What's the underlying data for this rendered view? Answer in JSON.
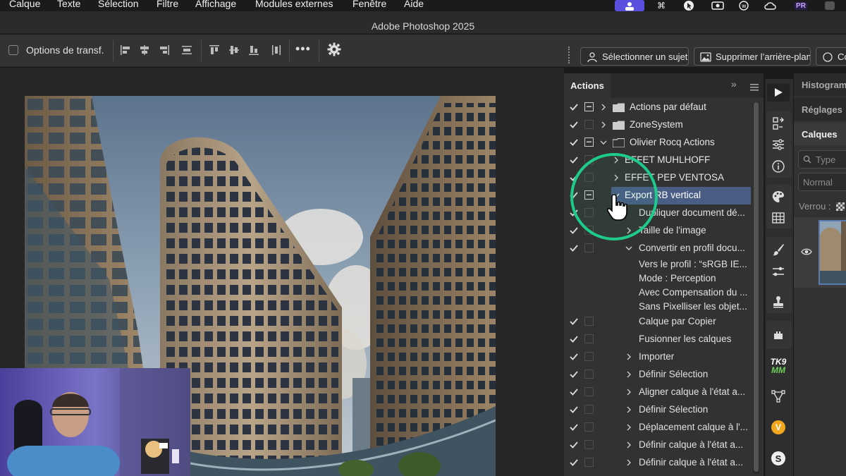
{
  "menubar": {
    "items": [
      "Calque",
      "Texte",
      "Sélection",
      "Filtre",
      "Affichage",
      "Modules externes",
      "Fenêtre",
      "Aide"
    ],
    "tray_icons": [
      "profile-icon",
      "command-icon",
      "cursor-icon",
      "camera-icon",
      "whatsapp-icon",
      "creative-cloud-icon",
      "premiere-icon",
      "app-icon"
    ],
    "tray_labels": {
      "premiere": "PR"
    }
  },
  "window": {
    "title": "Adobe Photoshop 2025"
  },
  "options_bar": {
    "transform_label": "Options de transf.",
    "more_label": "•••"
  },
  "contextual_bar": {
    "select_subject": "Sélectionner un sujet",
    "remove_background": "Supprimer l’arrière-plan",
    "third_button": "Co"
  },
  "actions_panel": {
    "tab": "Actions",
    "collapse_label": "»",
    "sets": [
      {
        "label": "Actions par défaut",
        "checked": true,
        "dialog": true,
        "expanded": false
      },
      {
        "label": "ZoneSystem",
        "checked": true,
        "dialog": false,
        "expanded": false
      },
      {
        "label": "Olivier Rocq Actions",
        "checked": true,
        "dialog": true,
        "expanded": true
      }
    ],
    "actions": [
      {
        "label": "EFFET MUHLHOFF",
        "checked": true,
        "expanded": false
      },
      {
        "label": "EFFET PEP VENTOSA",
        "checked": true,
        "expanded": false
      },
      {
        "label": "Export RB vertical",
        "checked": true,
        "dialog": true,
        "expanded": true,
        "selected": true
      }
    ],
    "steps": [
      {
        "label": "Dupliquer document dé...",
        "expandable": false
      },
      {
        "label": "Taille de l'image",
        "expandable": true,
        "expanded": false
      },
      {
        "label": "Convertir en profil docu...",
        "expandable": true,
        "expanded": true
      },
      {
        "label": "Calque par Copier",
        "expandable": false
      },
      {
        "label": "Fusionner les calques",
        "expandable": false
      },
      {
        "label": "Importer",
        "expandable": true,
        "expanded": false
      },
      {
        "label": "Définir Sélection",
        "expandable": true,
        "expanded": false
      },
      {
        "label": "Aligner calque à l'état a...",
        "expandable": true,
        "expanded": false
      },
      {
        "label": "Définir Sélection",
        "expandable": true,
        "expanded": false
      },
      {
        "label": "Déplacement calque à l'...",
        "expandable": true,
        "expanded": false
      },
      {
        "label": "Définir calque à l'état a...",
        "expandable": true,
        "expanded": false
      },
      {
        "label": "Définir calque à l'état a...",
        "expandable": true,
        "expanded": false
      }
    ],
    "step_details": [
      "Vers le profil :  “sRGB IE...",
      "Mode : Perception",
      "Avec Compensation du ...",
      "Sans Pixelliser les objet..."
    ]
  },
  "tool_strip": {
    "icons": [
      "play-icon",
      "history-icon",
      "adjust-sliders-icon",
      "info-icon",
      "color-palette-icon",
      "grid-icon",
      "brush-icon",
      "brush-settings-icon",
      "clone-stamp-icon",
      "plugin-icon",
      "tk9-icon",
      "path-icon",
      "v-plugin-icon",
      "s-plugin-icon"
    ],
    "tk9_label": "TK9",
    "tk9_sub": "MM",
    "v_label": "V",
    "s_label": "S"
  },
  "layers_panel": {
    "tabs": [
      "Histogramme",
      "Réglages",
      "Calques"
    ],
    "active_tab": "Calques",
    "filter_placeholder": "Type",
    "blend_mode": "Normal",
    "lock_label": "Verrou :"
  },
  "colors": {
    "accent_selection": "#4a5d84",
    "highlight_circle": "#1ecb8a",
    "menubar_accent": "#5b4fe0"
  }
}
